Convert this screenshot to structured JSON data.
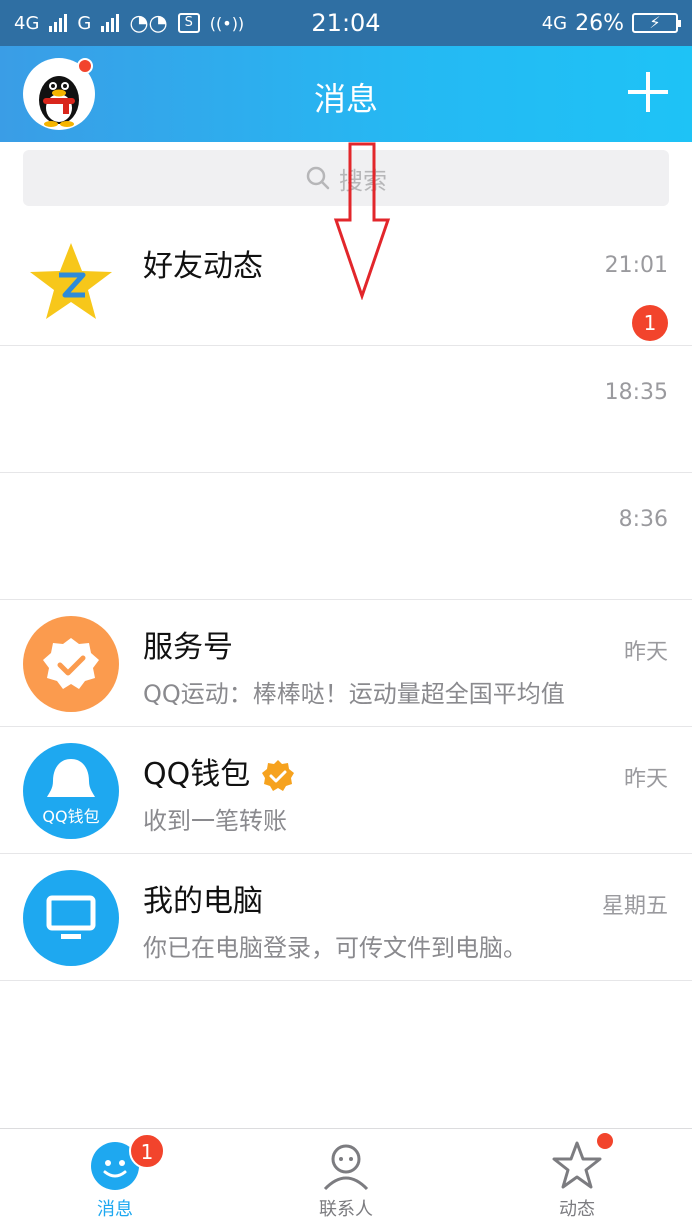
{
  "status_bar": {
    "net1": "4G",
    "net2": "G",
    "time": "21:04",
    "net3": "4G",
    "battery": "26%"
  },
  "header": {
    "title": "消息"
  },
  "search": {
    "placeholder": "搜索"
  },
  "conversations": [
    {
      "title": "好友动态",
      "subtitle": "",
      "time": "21:01",
      "badge": "1"
    },
    {
      "title": "",
      "subtitle": "",
      "time": "18:35"
    },
    {
      "title": "",
      "subtitle": "",
      "time": "8:36"
    },
    {
      "title": "服务号",
      "subtitle": "QQ运动：棒棒哒！运动量超全国平均值",
      "time": "昨天"
    },
    {
      "title": "QQ钱包",
      "subtitle": "收到一笔转账",
      "time": "昨天",
      "icon_text": "QQ钱包"
    },
    {
      "title": "我的电脑",
      "subtitle": "你已在电脑登录，可传文件到电脑。",
      "time": "星期五"
    }
  ],
  "tabs": [
    {
      "label": "消息",
      "badge": "1"
    },
    {
      "label": "联系人"
    },
    {
      "label": "动态"
    }
  ],
  "colors": {
    "header_start": "#3a9de6",
    "header_end": "#1ec3f6",
    "badge": "#f2442c",
    "active_tab": "#1ea8f0"
  }
}
